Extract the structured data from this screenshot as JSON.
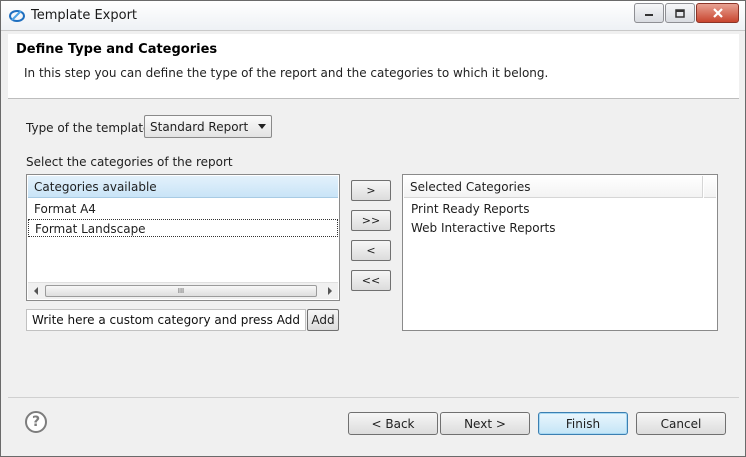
{
  "window": {
    "title": "Template Export"
  },
  "header": {
    "title": "Define Type and Categories",
    "description": "In this step you can define the type of the report and the categories to which it belong."
  },
  "type_field": {
    "label": "Type of the template:",
    "selected": "Standard Report"
  },
  "categories": {
    "label": "Select the categories of the report",
    "available_header": "Categories available",
    "available_items": [
      "Format A4",
      "Format Landscape"
    ],
    "scrollbar_grip": "III",
    "custom_placeholder": "Write here a custom category and press Add",
    "add_label": "Add",
    "move_buttons": [
      ">",
      ">>",
      "<",
      "<<"
    ],
    "selected_header": "Selected Categories",
    "selected_items": [
      "Print Ready Reports",
      "Web Interactive Reports"
    ]
  },
  "footer": {
    "help": "?",
    "back_label": "< Back",
    "next_label": "Next >",
    "finish_label": "Finish",
    "cancel_label": "Cancel"
  },
  "colors": {
    "list_header_bg": "#c9e4f7",
    "primary_button_border": "#3c7fb1",
    "close_button": "#c8452f"
  }
}
